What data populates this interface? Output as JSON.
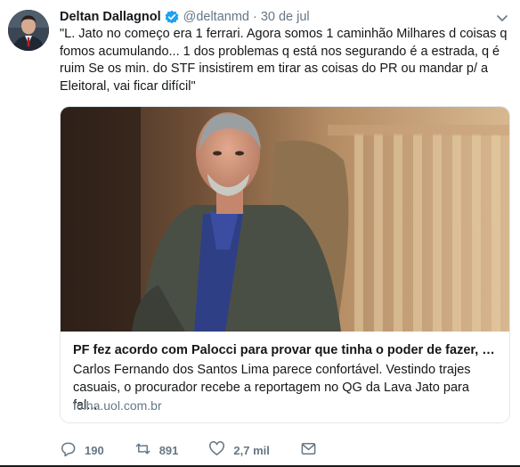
{
  "author": {
    "name": "Deltan Dallagnol",
    "handle": "@deltanmd",
    "separator": "·",
    "date": "30 de jul",
    "verified": true
  },
  "tweet": {
    "text": "\"L. Jato no começo era 1 ferrari. Agora somos 1 caminhão Milhares d coisas q fomos acumulando... 1 dos problemas q está nos segurando é a estrada, q é ruim Se os min. do STF insistirem em tirar as coisas do PR ou mandar p/ a Eleitoral, vai ficar difícil\""
  },
  "card": {
    "title": "PF fez acordo com Palocci para provar que tinha o poder de fazer, di...",
    "description": "Carlos Fernando dos Santos Lima parece confortável. Vestindo trajes casuais, o procurador recebe a reportagem no QG da Lava Jato para fal...",
    "domain": "folha.uol.com.br"
  },
  "actions": {
    "replies": "190",
    "retweets": "891",
    "likes": "2,7 mil"
  },
  "icons": {
    "verified": "verified-badge-icon",
    "menu": "chevron-down-icon",
    "reply": "reply-icon",
    "retweet": "retweet-icon",
    "like": "heart-icon",
    "dm": "envelope-icon"
  },
  "colors": {
    "accent": "#1da1f2",
    "secondary_text": "#657786",
    "border": "#e1e8ed"
  }
}
